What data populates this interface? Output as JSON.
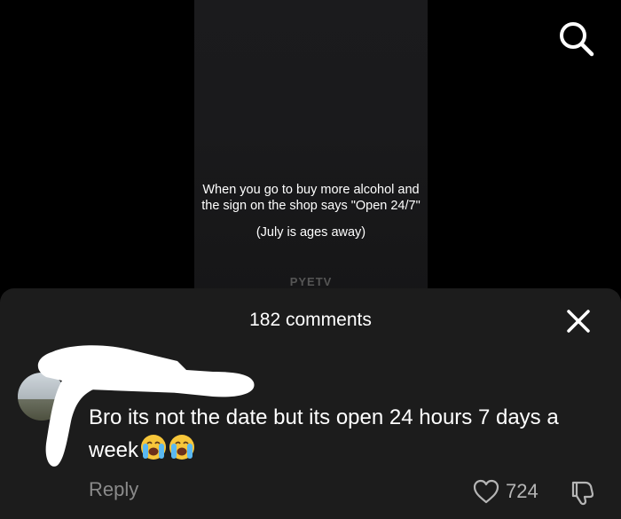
{
  "video": {
    "caption_main": "When you go to buy more alcohol and the sign on the shop says \"Open 24/7\"",
    "caption_sub": "(July is ages away)",
    "watermark": "PYETV"
  },
  "comments_panel": {
    "count_label": "182 comments",
    "comment": {
      "text": "Bro its not the date but its open 24 hours 7 days a week",
      "reply_label": "Reply",
      "likes": "724"
    }
  },
  "icons": {
    "search": "search-icon",
    "close": "close-icon",
    "like": "heart-icon",
    "dislike": "thumbs-down-icon",
    "emoji": "loudly-crying-face-emoji"
  }
}
